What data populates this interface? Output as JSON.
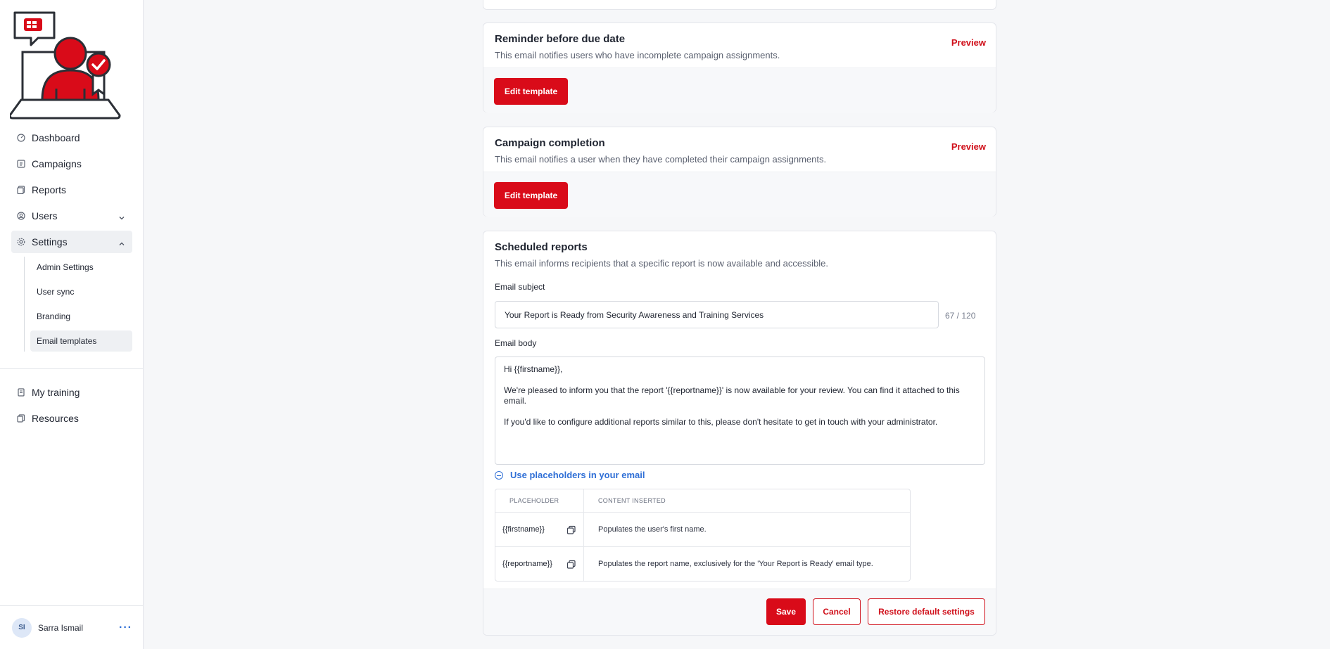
{
  "user": {
    "initials": "SI",
    "name": "Sarra Ismail",
    "more": "···"
  },
  "nav": {
    "dashboard": "Dashboard",
    "campaigns": "Campaigns",
    "reports": "Reports",
    "users": "Users",
    "settings": "Settings",
    "settings_sub": {
      "admin": "Admin Settings",
      "user_sync": "User sync",
      "branding": "Branding",
      "email_templates": "Email templates"
    },
    "my_training": "My training",
    "resources": "Resources"
  },
  "cards": {
    "reminder": {
      "title": "Reminder before due date",
      "description": "This email notifies users who have incomplete campaign assignments.",
      "preview": "Preview",
      "edit": "Edit template"
    },
    "completion": {
      "title": "Campaign completion",
      "description": "This email notifies a user when they have completed their campaign assignments.",
      "preview": "Preview",
      "edit": "Edit template"
    },
    "scheduled": {
      "title": "Scheduled reports",
      "description": "This email informs recipients that a specific report is now available and accessible.",
      "subject_label": "Email subject",
      "subject_value": "Your Report is Ready from Security Awareness and Training Services",
      "subject_counter": "67 / 120",
      "body_label": "Email body",
      "body_value": "Hi {{firstname}},\n\nWe're pleased to inform you that the report '{{reportname}}' is now available for your review. You can find it attached to this email.\n\nIf you'd like to configure additional reports similar to this, please don't hesitate to get in touch with your administrator.",
      "placeholders_toggle": "Use placeholders in your email",
      "table": {
        "headers": [
          "PLACEHOLDER",
          "CONTENT INSERTED"
        ],
        "rows": [
          {
            "placeholder": "{{firstname}}",
            "content": "Populates the user's first name."
          },
          {
            "placeholder": "{{reportname}}",
            "content": "Populates the report name, exclusively for the 'Your Report is Ready' email type."
          }
        ]
      },
      "save": "Save",
      "cancel": "Cancel",
      "restore": "Restore default settings"
    }
  },
  "colors": {
    "brand_red": "#d90b19",
    "link_blue": "#2f6fd6"
  }
}
